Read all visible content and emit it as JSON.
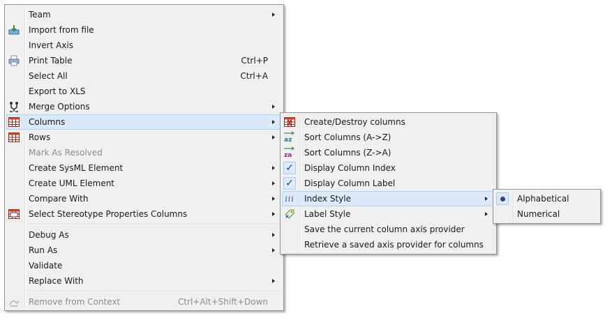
{
  "main_menu": {
    "items": [
      {
        "label": "Team",
        "icon": "",
        "submenu": true
      },
      {
        "label": "Import from file",
        "icon": "import-icon"
      },
      {
        "label": "Invert Axis"
      },
      {
        "label": "Print Table",
        "icon": "printer-icon",
        "shortcut": "Ctrl+P"
      },
      {
        "label": "Select All",
        "shortcut": "Ctrl+A"
      },
      {
        "label": "Export to XLS"
      },
      {
        "label": "Merge Options",
        "icon": "merge-icon",
        "submenu": true
      },
      {
        "label": "Columns",
        "icon": "table-icon",
        "submenu": true,
        "highlighted": true
      },
      {
        "label": "Rows",
        "icon": "table-icon",
        "submenu": true
      },
      {
        "label": "Mark As Resolved",
        "disabled": true
      },
      {
        "label": "Create SysML Element",
        "submenu": true
      },
      {
        "label": "Create UML Element",
        "submenu": true
      },
      {
        "label": "Compare With",
        "submenu": true
      },
      {
        "label": "Select Stereotype Properties Columns",
        "icon": "stereotype-table-icon",
        "submenu": true
      },
      {
        "label": "Debug As",
        "submenu": true
      },
      {
        "label": "Run As",
        "submenu": true
      },
      {
        "label": "Validate"
      },
      {
        "label": "Replace With",
        "submenu": true
      },
      {
        "label": "Remove from Context",
        "icon": "remove-icon",
        "shortcut": "Ctrl+Alt+Shift+Down",
        "disabled": true
      }
    ]
  },
  "columns_menu": {
    "items": [
      {
        "label": "Create/Destroy columns",
        "icon": "create-destroy-columns-icon"
      },
      {
        "label": "Sort Columns (A->Z)",
        "icon": "sort-az-icon"
      },
      {
        "label": "Sort Columns (Z->A)",
        "icon": "sort-za-icon"
      },
      {
        "label": "Display Column Index",
        "checked": true
      },
      {
        "label": "Display Column Label",
        "checked": true
      },
      {
        "label": "Index Style",
        "icon": "index-style-icon",
        "submenu": true,
        "highlighted": true
      },
      {
        "label": "Label Style",
        "icon": "label-style-icon",
        "submenu": true
      },
      {
        "label": "Save the current column axis provider"
      },
      {
        "label": "Retrieve a saved axis provider for columns"
      }
    ]
  },
  "index_style_menu": {
    "items": [
      {
        "label": "Alphabetical",
        "selected": true
      },
      {
        "label": "Numerical"
      }
    ]
  },
  "glyphs": {
    "check": "✓",
    "sort_az": "az",
    "sort_za": "za",
    "index_style": "iii"
  }
}
